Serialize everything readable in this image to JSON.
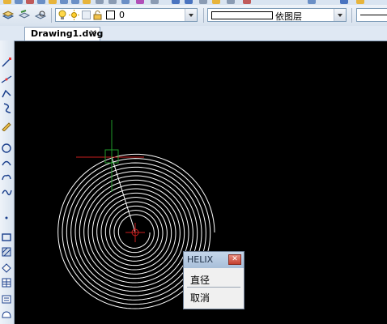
{
  "toolbar": {
    "layer_value": "0",
    "color_value": "依图层"
  },
  "document_tab": {
    "title": "Drawing1.dwg",
    "close_glyph": "✕"
  },
  "helix_menu": {
    "title": "HELIX",
    "close_glyph": "✕",
    "options": [
      "直径",
      "取消"
    ]
  },
  "drawing": {
    "background": "#000000",
    "helix_color": "#ffffff",
    "crosshair_color": "#c81e1e",
    "ucs_x_color": "#c81e1e",
    "ucs_y_color": "#1f9a2a"
  }
}
